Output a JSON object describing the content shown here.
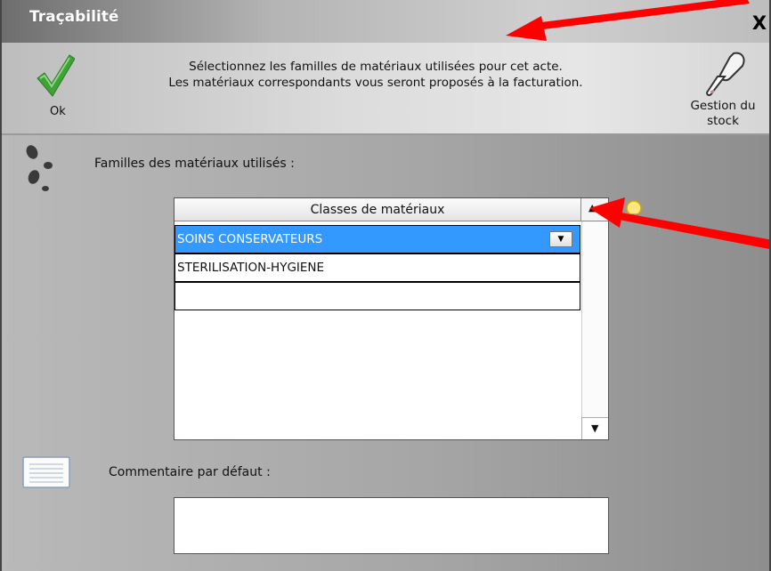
{
  "window": {
    "title": "Traçabilité",
    "close_label": "X"
  },
  "header": {
    "ok_label": "Ok",
    "instructions_line1": "Sélectionnez les familles de matériaux utilisées pour cet acte.",
    "instructions_line2": "Les matériaux correspondants vous seront proposés à la facturation.",
    "stock_label_line1": "Gestion du",
    "stock_label_line2": "stock"
  },
  "families": {
    "label": "Familles des matériaux utilisés :",
    "column_header": "Classes de matériaux",
    "rows": [
      {
        "value": "SOINS CONSERVATEURS",
        "selected": true
      },
      {
        "value": "STERILISATION-HYGIENE",
        "selected": false
      },
      {
        "value": "",
        "selected": false
      }
    ]
  },
  "comment": {
    "label": "Commentaire par défaut :",
    "value": ""
  },
  "icons": {
    "ok": "checkmark-icon",
    "stock": "trowel-icon",
    "steps": "footsteps-icon",
    "bulb": "lightbulb-icon",
    "comment": "notepad-icon"
  },
  "colors": {
    "selection": "#3399ff",
    "ok_check": "#3fa33a",
    "annotation_arrow": "#ff0000"
  }
}
